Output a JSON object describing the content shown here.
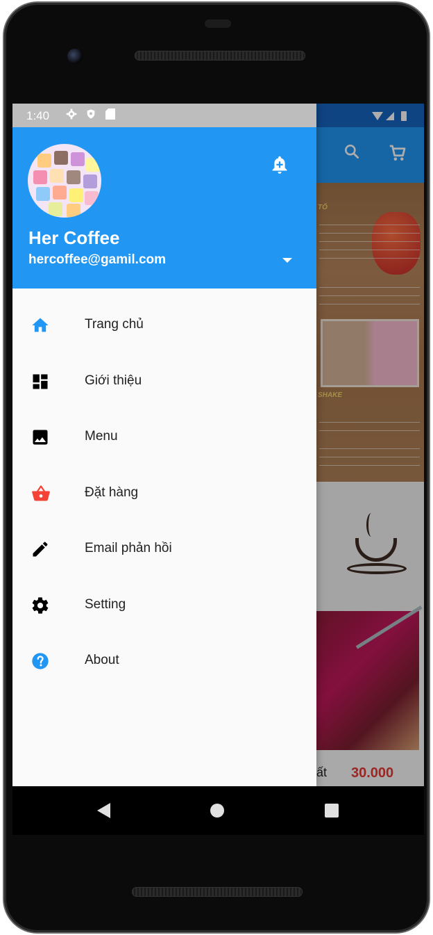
{
  "status_bar": {
    "time": "1:40"
  },
  "drawer_header": {
    "name": "Her Coffee",
    "email": "hercoffee@gamil.com",
    "color": "#2196f3"
  },
  "menu": [
    {
      "label": "Trang chủ",
      "icon": "home-icon",
      "color": "#2196f3"
    },
    {
      "label": "Giới thiệu",
      "icon": "dashboard-icon",
      "color": "#000000"
    },
    {
      "label": "Menu",
      "icon": "image-icon",
      "color": "#000000"
    },
    {
      "label": "Đặt hàng",
      "icon": "shopping-basket-icon",
      "color": "#f44336"
    },
    {
      "label": "Email phản hồi",
      "icon": "pencil-icon",
      "color": "#000000"
    },
    {
      "label": "Setting",
      "icon": "gear-icon",
      "color": "#000000"
    },
    {
      "label": "About",
      "icon": "help-icon",
      "color": "#2196f3"
    }
  ],
  "background_app": {
    "price_item_name": "ất",
    "price": "30.000"
  }
}
